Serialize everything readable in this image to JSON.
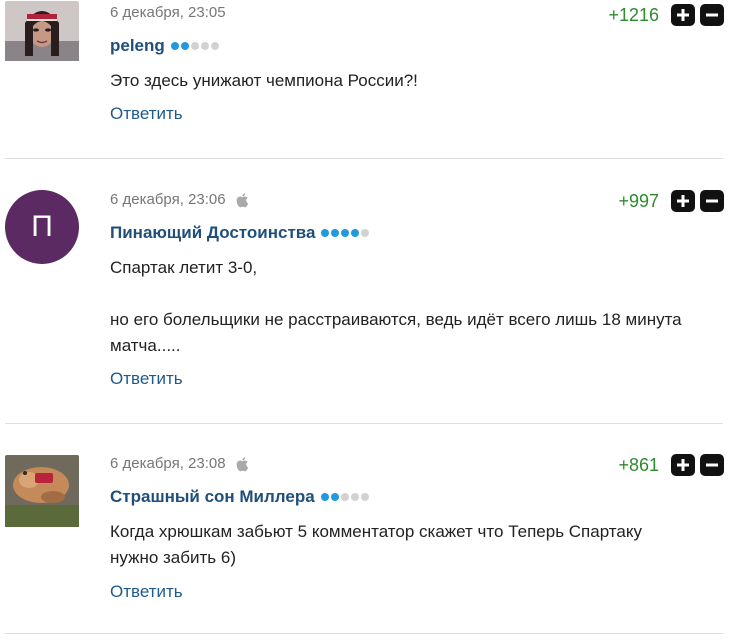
{
  "comments": [
    {
      "date": "6 декабря, 23:05",
      "author": "peleng",
      "rating_level": 2,
      "text": "Это здесь унижают чемпиона России?!",
      "reply_label": "Ответить",
      "score": "+1216",
      "show_apple": false
    },
    {
      "date": "6 декабря, 23:06",
      "author": "Пинающий Достоинства",
      "rating_level": 4,
      "avatar_letter": "П",
      "text": "Спартак летит 3-0,\n\nно его болельщики не расстраиваются, ведь идёт всего лишь 18 минута матча.....",
      "reply_label": "Ответить",
      "score": "+997",
      "show_apple": true
    },
    {
      "date": "6 декабря, 23:08",
      "author": "Страшный сон Миллера",
      "rating_level": 2,
      "text": "Когда хрюшкам забьют 5 комментатор скажет что Теперь Спартаку нужно забить 6)",
      "reply_label": "Ответить",
      "score": "+861",
      "show_apple": true
    }
  ],
  "colors": {
    "author": "#1f4f7a",
    "reply": "#1f5a8c",
    "score": "#2e8b2e",
    "dot_on": "#2299dd",
    "avatar_letter_bg": "#5b2a63"
  },
  "icons": {
    "vote_up": "plus-icon",
    "vote_down": "minus-icon",
    "platform": "apple-icon"
  }
}
